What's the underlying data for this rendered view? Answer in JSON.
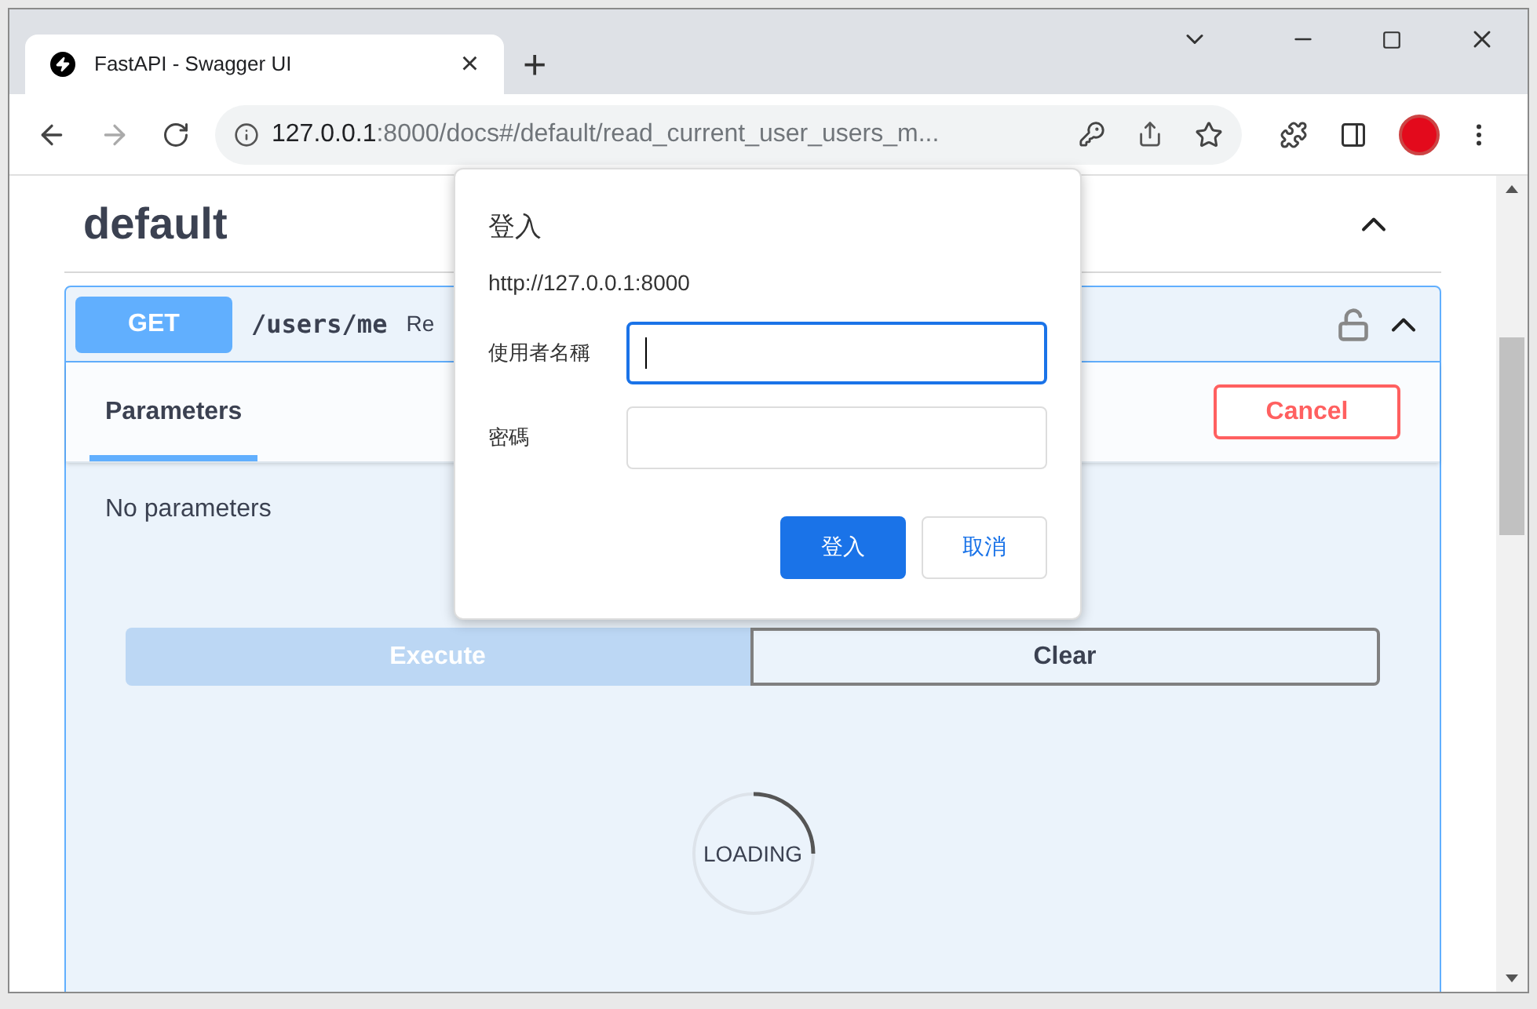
{
  "browser": {
    "tab": {
      "title": "FastAPI - Swagger UI",
      "close": "×"
    },
    "new_tab": "+",
    "address": {
      "host": "127.0.0.1",
      "path": ":8000/docs#/default/read_current_user_users_m..."
    }
  },
  "page": {
    "section_title": "default",
    "operation": {
      "method": "GET",
      "path": "/users/me",
      "summary": "Re",
      "locked": false
    },
    "tabs": [
      {
        "label": "Parameters",
        "selected": true
      }
    ],
    "cancel": "Cancel",
    "no_params": "No parameters",
    "execute": {
      "label": "Execute",
      "disabled": true
    },
    "clear": "Clear",
    "loading": "LOADING"
  },
  "dialog": {
    "title": "登入",
    "origin": "http://127.0.0.1:8000",
    "fields": [
      {
        "label": "使用者名稱",
        "focused": true
      },
      {
        "label": "密碼",
        "focused": false
      }
    ],
    "buttons": [
      {
        "label": "登入",
        "kind": "primary"
      },
      {
        "label": "取消",
        "kind": "secondary"
      }
    ]
  }
}
